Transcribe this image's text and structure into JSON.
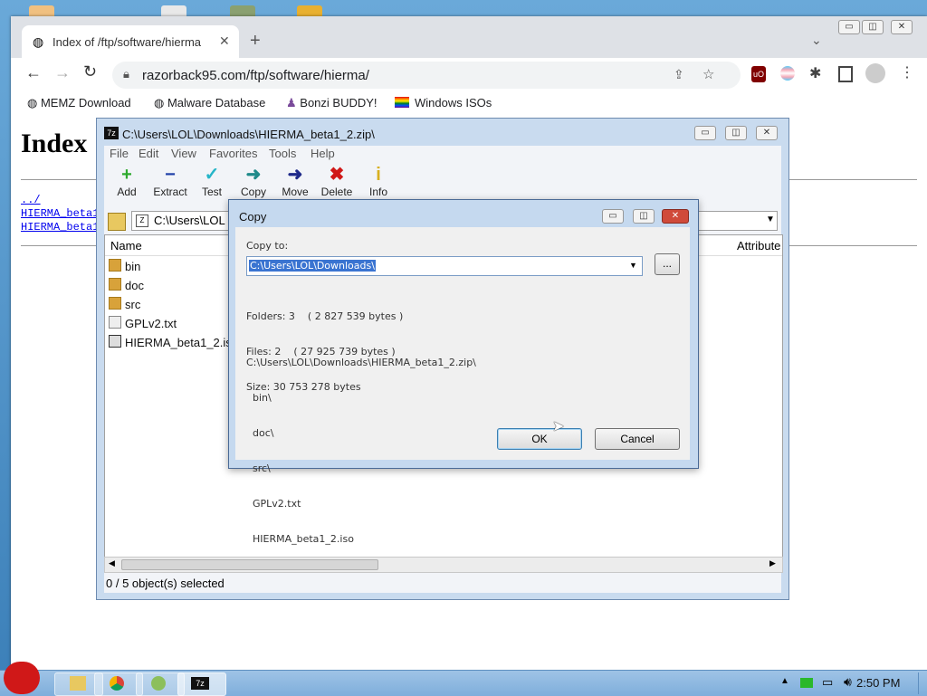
{
  "browser": {
    "tab_title": "Index of /ftp/software/hierma",
    "new_tab_glyph": "+",
    "url": "razorback95.com/ftp/software/hierma/",
    "bookmarks": [
      "MEMZ Download",
      "Malware Database",
      "Bonzi BUDDY!",
      "Windows ISOs"
    ],
    "page_heading": "Index",
    "links": [
      "../",
      "HIERMA_beta1",
      "HIERMA_beta1"
    ]
  },
  "zip": {
    "title": "C:\\Users\\LOL\\Downloads\\HIERMA_beta1_2.zip\\",
    "menu": [
      "File",
      "Edit",
      "View",
      "Favorites",
      "Tools",
      "Help"
    ],
    "tools": [
      {
        "label": "Add",
        "icon": "add-icon",
        "color": "#2eaa2e",
        "glyph": "+"
      },
      {
        "label": "Extract",
        "icon": "extract-icon",
        "color": "#1f3fa8",
        "glyph": "−"
      },
      {
        "label": "Test",
        "icon": "test-icon",
        "color": "#26b5c8",
        "glyph": "✓"
      },
      {
        "label": "Copy",
        "icon": "copy-icon",
        "color": "#1f8a8a",
        "glyph": "➜"
      },
      {
        "label": "Move",
        "icon": "move-icon",
        "color": "#1f2a8a",
        "glyph": "➜"
      },
      {
        "label": "Delete",
        "icon": "delete-icon",
        "color": "#d01818",
        "glyph": "✖"
      },
      {
        "label": "Info",
        "icon": "info-icon",
        "color": "#d8b020",
        "glyph": "i"
      }
    ],
    "address": "C:\\Users\\LOL",
    "columns": {
      "name": "Name",
      "attributes": "Attribute"
    },
    "files": [
      {
        "name": "bin",
        "type": "folder"
      },
      {
        "name": "doc",
        "type": "folder"
      },
      {
        "name": "src",
        "type": "folder"
      },
      {
        "name": "GPLv2.txt",
        "type": "text"
      },
      {
        "name": "HIERMA_beta1_2.iso",
        "type": "iso"
      }
    ],
    "status": "0 / 5 object(s) selected"
  },
  "dialog": {
    "title": "Copy",
    "copy_to_label": "Copy to:",
    "path_value": "C:\\Users\\LOL\\Downloads\\",
    "browse_label": "...",
    "folders": "Folders: 3    ( 2 827 539 bytes )",
    "files": "Files: 2    ( 27 925 739 bytes )",
    "size": "Size: 30 753 278 bytes",
    "tree": [
      "C:\\Users\\LOL\\Downloads\\HIERMA_beta1_2.zip\\",
      "  bin\\",
      "  doc\\",
      "  src\\",
      "  GPLv2.txt",
      "  HIERMA_beta1_2.iso"
    ],
    "ok_label": "OK",
    "cancel_label": "Cancel"
  },
  "taskbar": {
    "clock": "2:50 PM"
  }
}
